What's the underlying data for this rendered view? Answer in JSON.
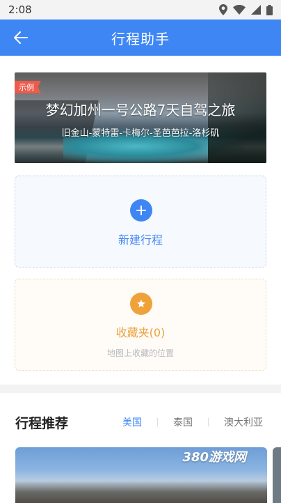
{
  "status_bar": {
    "time": "2:08",
    "icons": [
      "location-icon",
      "wifi-icon",
      "signal-icon",
      "battery-icon"
    ]
  },
  "app_bar": {
    "title": "行程助手",
    "back_icon": "arrow-left-icon"
  },
  "hero": {
    "badge": "示例",
    "title": "梦幻加州一号公路7天自驾之旅",
    "subtitle": "旧金山-蒙特雷-卡梅尔-圣芭芭拉-洛杉矶"
  },
  "new_trip": {
    "label": "新建行程",
    "icon": "plus-icon"
  },
  "favorites": {
    "label": "收藏夹(0)",
    "sub": "地图上收藏的位置",
    "icon": "star-icon"
  },
  "recommend": {
    "title": "行程推荐",
    "tabs": [
      {
        "label": "美国",
        "active": true
      },
      {
        "label": "泰国",
        "active": false
      },
      {
        "label": "澳大利亚",
        "active": false
      }
    ],
    "watermark": "380游戏网"
  },
  "colors": {
    "primary": "#3f86f5",
    "accent": "#f0a23a",
    "badge": "#ee5b4b"
  }
}
